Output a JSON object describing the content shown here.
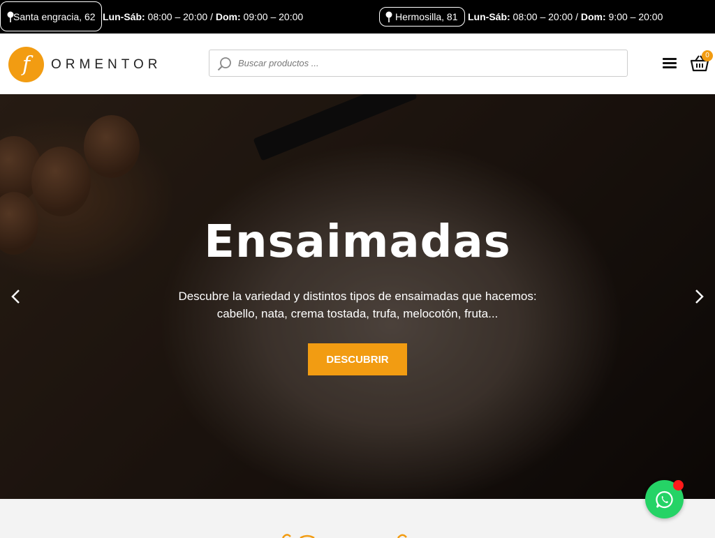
{
  "topbar": {
    "store1": {
      "address": "Santa engracia, 62",
      "days1": "Lun-Sáb:",
      "hours1": " 08:00 – 20:00 / ",
      "days2": "Dom:",
      "hours2": " 09:00 – 20:00"
    },
    "store2": {
      "address": "Hermosilla, 81",
      "days1": "Lun-Sáb:",
      "hours1": " 08:00 – 20:00 / ",
      "days2": "Dom:",
      "hours2": " 9:00 – 20:00"
    }
  },
  "header": {
    "logo_letter": "f",
    "logo_text": "ORMENTOR",
    "search_placeholder": "Buscar productos ...",
    "cart_count": "0"
  },
  "hero": {
    "title": "Ensaimadas",
    "subtitle": "Descubre la variedad y distintos tipos de ensaimadas que hacemos: cabello, nata, crema tostada, trufa, melocotón, fruta...",
    "cta_label": "DESCUBRIR"
  },
  "colors": {
    "accent": "#f29c12",
    "topbar": "#000000",
    "whatsapp": "#25d366",
    "notification": "#ff1a1a"
  },
  "icons": [
    "location-pin-icon",
    "search-icon",
    "menu-icon",
    "basket-icon",
    "chevron-left-icon",
    "chevron-right-icon",
    "whatsapp-icon"
  ]
}
